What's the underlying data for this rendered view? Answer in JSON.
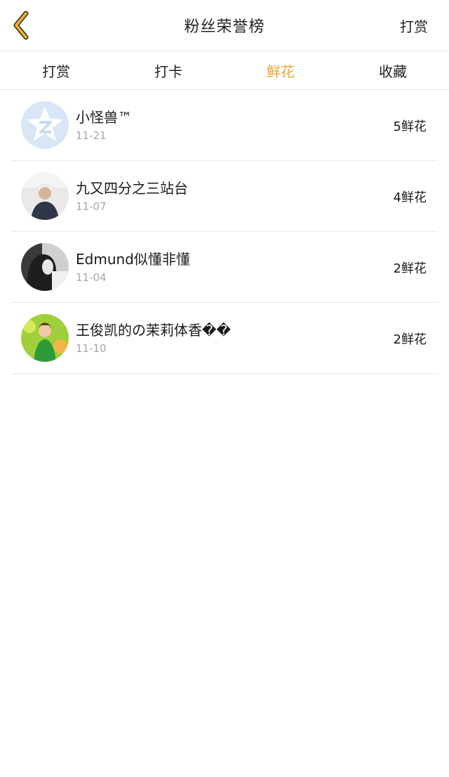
{
  "header": {
    "back_icon": "chevron-left-icon",
    "title": "粉丝荣誉榜",
    "right_label": "打赏",
    "accent_color": "#f2a531"
  },
  "tabs": [
    {
      "label": "打赏",
      "active": false
    },
    {
      "label": "打卡",
      "active": false
    },
    {
      "label": "鲜花",
      "active": true
    },
    {
      "label": "收藏",
      "active": false
    }
  ],
  "list": [
    {
      "name": "小怪兽™",
      "date": "11-21",
      "count": "5鲜花",
      "avatar": "qq-logo-avatar"
    },
    {
      "name": "九又四分之三站台",
      "date": "11-07",
      "count": "4鲜花",
      "avatar": "photo-avatar"
    },
    {
      "name": "Edmund似懂非懂",
      "date": "11-04",
      "count": "2鲜花",
      "avatar": "photo-avatar"
    },
    {
      "name": "王俊凯的の茉莉体香��",
      "date": "11-10",
      "count": "2鲜花",
      "avatar": "photo-avatar"
    }
  ]
}
